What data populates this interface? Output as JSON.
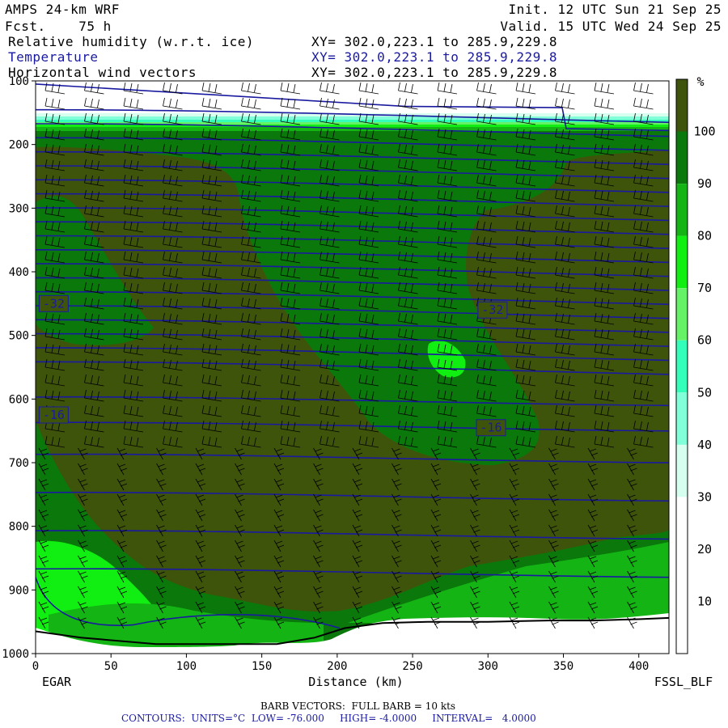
{
  "header": {
    "model": "AMPS 24-km WRF",
    "fcst": "Fcst.    75 h",
    "init": "Init. 12 UTC Sun 21 Sep 25",
    "valid": "Valid. 15 UTC Wed 24 Sep 25",
    "fields": [
      {
        "name": "Relative humidity (w.r.t. ice)",
        "xy": "XY= 302.0,223.1 to 285.9,229.8",
        "color": "#000000"
      },
      {
        "name": "Temperature",
        "xy": "XY= 302.0,223.1 to 285.9,229.8",
        "color": "#1a1aa0"
      },
      {
        "name": "Horizontal wind vectors",
        "xy": "XY= 302.0,223.1 to 285.9,229.8",
        "color": "#000000"
      }
    ]
  },
  "chart_data": {
    "type": "heatmap",
    "xlabel": "Distance (km)",
    "xlim": [
      0,
      420
    ],
    "ylim": [
      1000,
      100
    ],
    "xticks": [
      0,
      50,
      100,
      150,
      200,
      250,
      300,
      350,
      400
    ],
    "yticks": [
      100,
      200,
      300,
      400,
      500,
      600,
      700,
      800,
      900,
      1000
    ],
    "left_endpoint": "EGAR",
    "right_endpoint": "FSSL_BLF",
    "colorbar": {
      "unit": "%",
      "levels": [
        10,
        20,
        30,
        40,
        50,
        60,
        70,
        80,
        90,
        100
      ],
      "colors": [
        "#ffffff",
        "#ffffff",
        "#ffffff",
        "#d6fff0",
        "#80ffd8",
        "#33ffbb",
        "#66f266",
        "#11ee11",
        "#13b413",
        "#0b780b",
        "#3f540b"
      ]
    },
    "temperature_contour_labels": [
      {
        "label": "-32",
        "x_km": 12,
        "p_hpa": 450
      },
      {
        "label": "-32",
        "x_km": 303,
        "p_hpa": 460
      },
      {
        "label": "-16",
        "x_km": 12,
        "p_hpa": 625
      },
      {
        "label": "-16",
        "x_km": 302,
        "p_hpa": 645
      }
    ],
    "surface_pressure": {
      "x_km": [
        0,
        30,
        80,
        120,
        160,
        185,
        205,
        230,
        260,
        300,
        340,
        370,
        400,
        420
      ],
      "p_hpa": [
        965,
        975,
        985,
        985,
        985,
        975,
        960,
        952,
        950,
        950,
        948,
        948,
        946,
        944
      ]
    }
  },
  "footer": {
    "barb": "BARB VECTORS:  FULL BARB = 10 kts",
    "contours": "CONTOURS:  UNITS=°C  LOW= -76.000     HIGH= -4.0000     INTERVAL=   4.0000"
  }
}
